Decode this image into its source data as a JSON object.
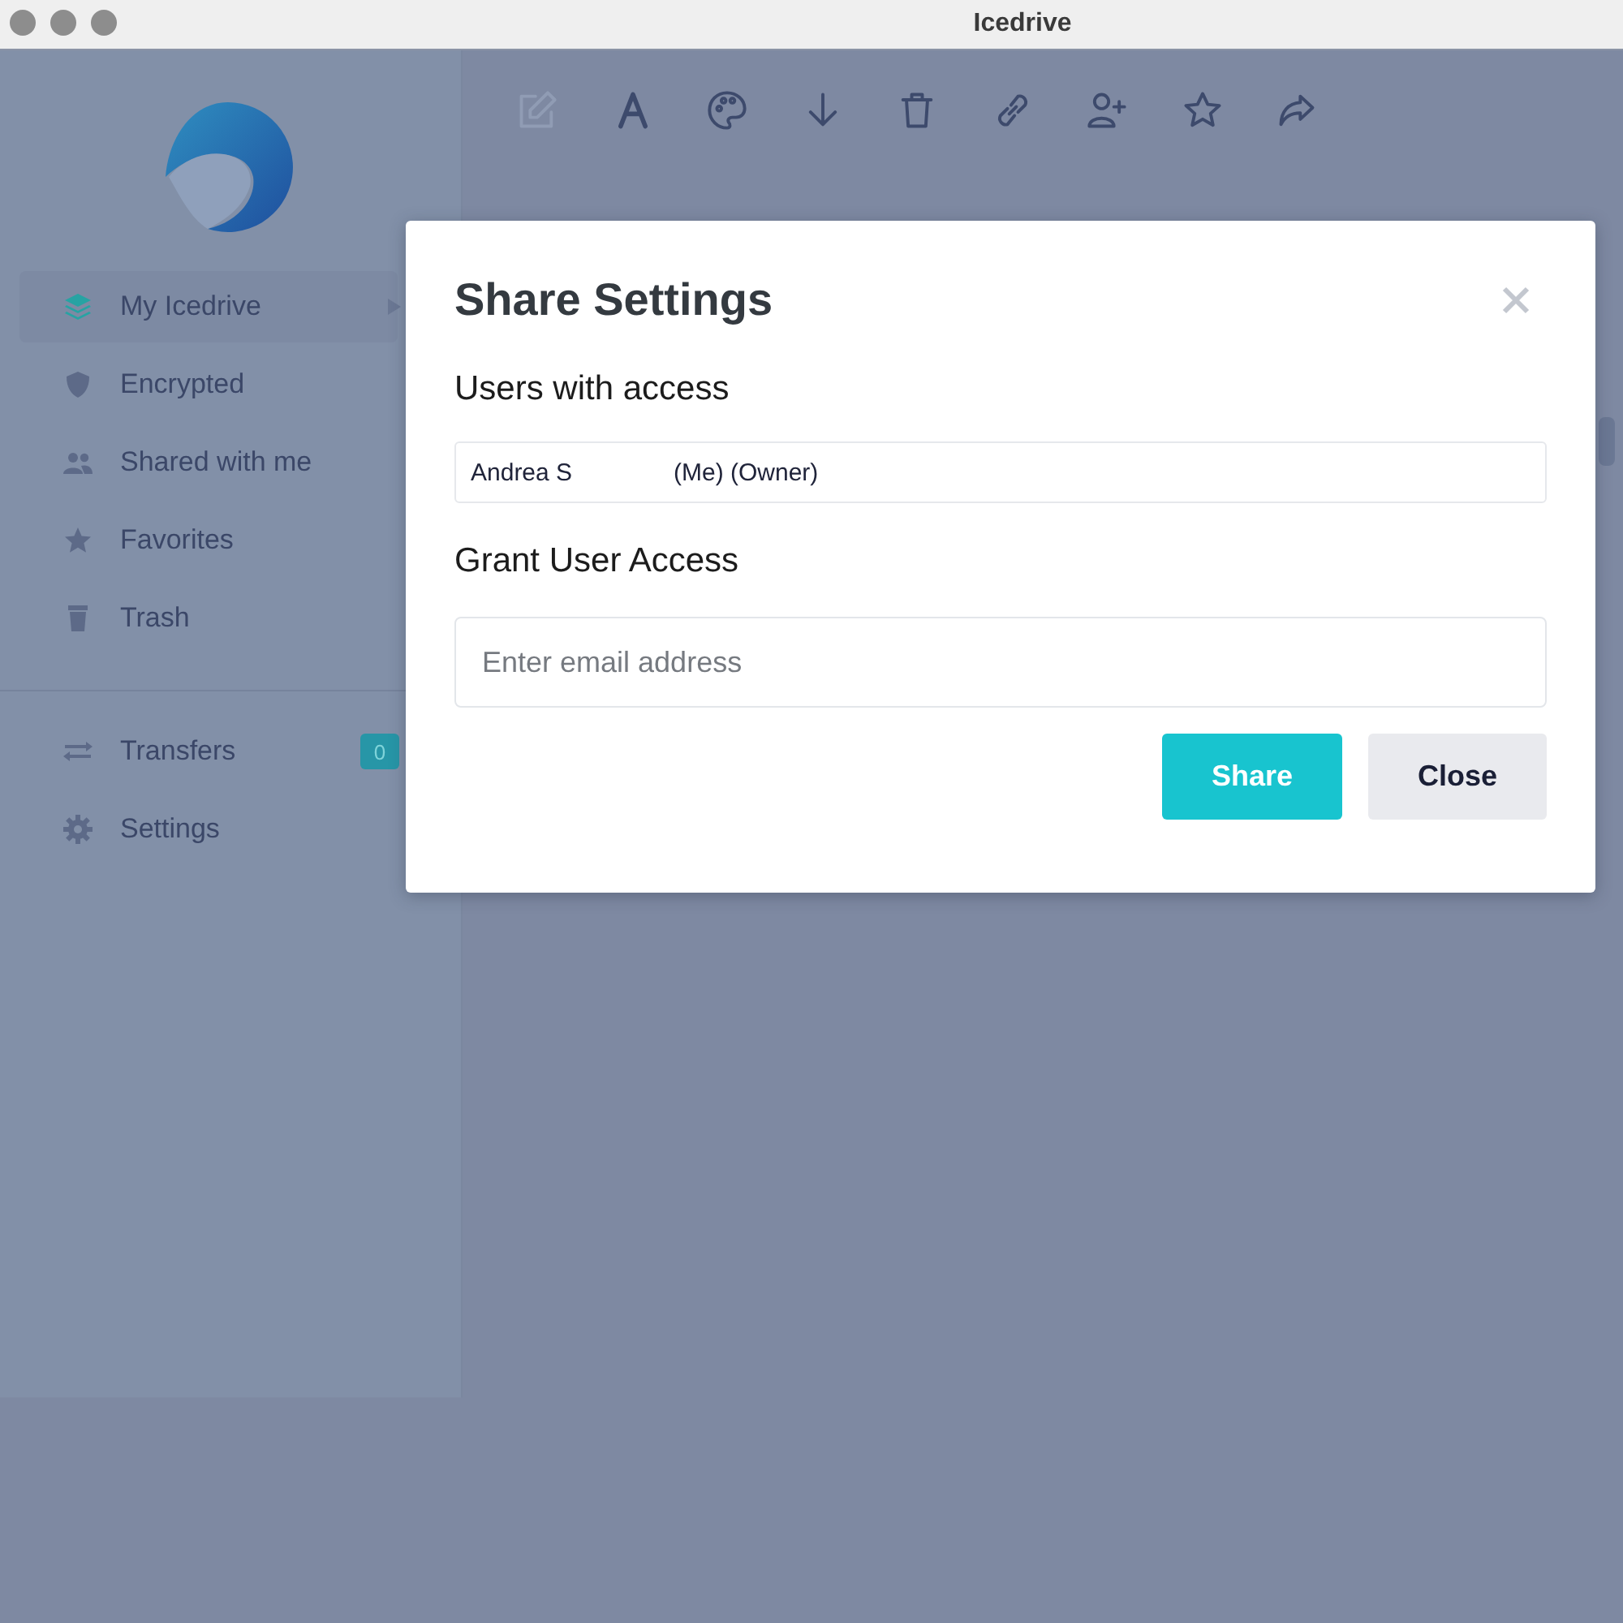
{
  "window": {
    "title": "Icedrive"
  },
  "sidebar": {
    "items": [
      {
        "label": "My Icedrive",
        "selected": true,
        "expandable": true
      },
      {
        "label": "Encrypted",
        "selected": false,
        "expandable": false
      },
      {
        "label": "Shared with me",
        "selected": false,
        "expandable": false
      },
      {
        "label": "Favorites",
        "selected": false,
        "expandable": false
      },
      {
        "label": "Trash",
        "selected": false,
        "expandable": false
      }
    ],
    "bottom_items": [
      {
        "label": "Transfers",
        "badge": "0"
      },
      {
        "label": "Settings"
      }
    ]
  },
  "toolbar": [
    {
      "disabled": true
    },
    {
      "disabled": false
    },
    {
      "disabled": false
    },
    {
      "disabled": false
    },
    {
      "disabled": false
    },
    {
      "disabled": false
    },
    {
      "disabled": false
    },
    {
      "disabled": false
    },
    {
      "disabled": false
    }
  ],
  "dialog": {
    "title": "Share Settings",
    "users_heading": "Users with access",
    "users": [
      {
        "name": "Andrea S",
        "role": "(Me) (Owner)"
      }
    ],
    "grant_heading": "Grant User Access",
    "email": {
      "placeholder": "Enter email address"
    },
    "buttons": [
      {
        "label": "Share",
        "kind": "primary"
      },
      {
        "label": "Close",
        "kind": "secondary"
      }
    ]
  }
}
